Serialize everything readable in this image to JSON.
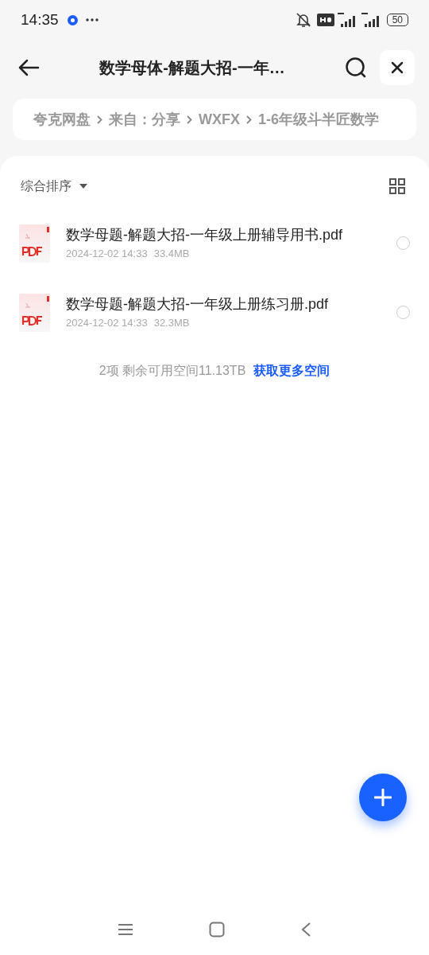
{
  "status_bar": {
    "time": "14:35",
    "battery": "50"
  },
  "header": {
    "title": "数学母体-解题大招-一年…"
  },
  "breadcrumb": [
    "夸克网盘",
    "来自：分享",
    "WXFX",
    "1-6年级斗半匠数学"
  ],
  "toolbar": {
    "sort": "综合排序"
  },
  "files": [
    {
      "name": "数学母题-解题大招-一年级上册辅导用书.pdf",
      "date": "2024-12-02 14:33",
      "size": "33.4MB",
      "selected": false
    },
    {
      "name": "数学母题-解题大招-一年级上册练习册.pdf",
      "date": "2024-12-02 14:33",
      "size": "32.3MB",
      "selected": false
    }
  ],
  "footer": {
    "summary": "2项 剩余可用空间11.13TB",
    "link": "获取更多空间"
  }
}
